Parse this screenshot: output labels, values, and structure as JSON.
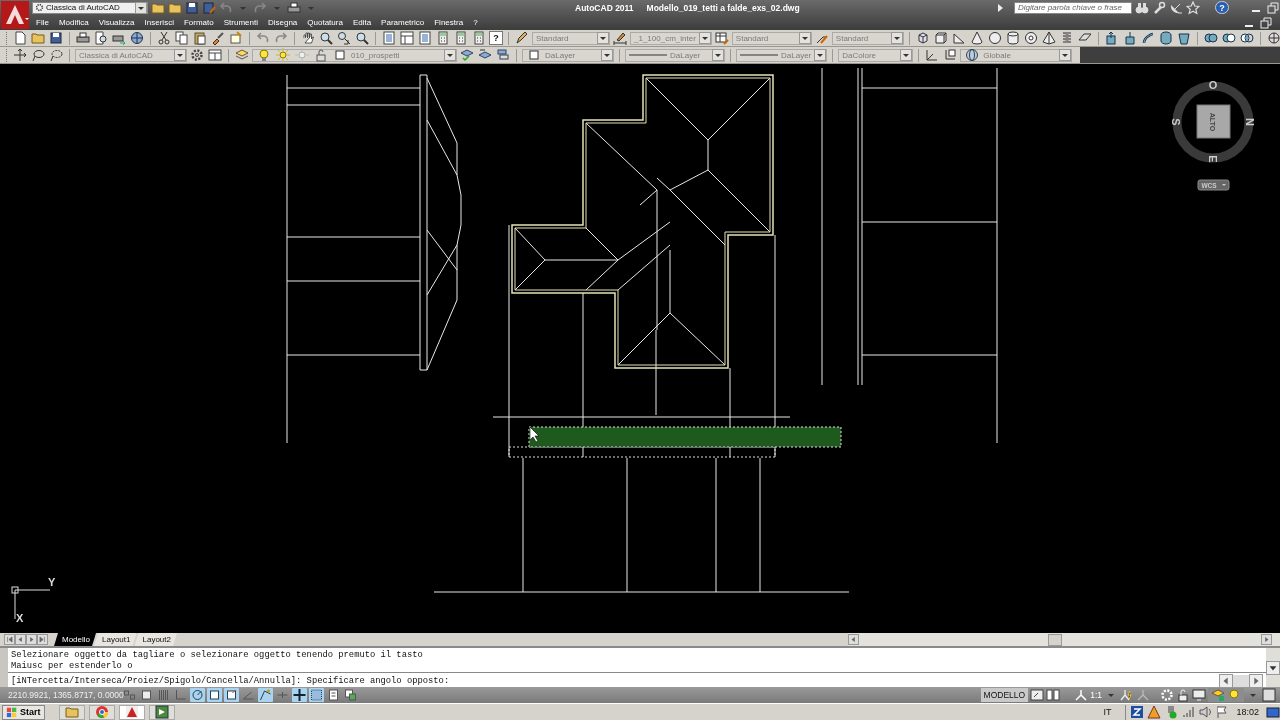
{
  "title_bar": {
    "workspace": "Classica di AutoCAD",
    "app_name": "AutoCAD 2011",
    "document": "Modello_019_tetti a falde_exs_02.dwg",
    "search": {
      "placeholder": "Digitare parola chiave o frase"
    },
    "help": "?"
  },
  "menu": [
    "File",
    "Modifica",
    "Visualizza",
    "Inserisci",
    "Formato",
    "Strumenti",
    "Disegna",
    "Quotatura",
    "Edita",
    "Parametrico",
    "Finestra",
    "?"
  ],
  "toolbar_1": {
    "help": "?",
    "styles": [
      {
        "value": "Standard"
      },
      {
        "value": "_1_100_cm_inter"
      },
      {
        "value": "Standard"
      },
      {
        "value": "Standard"
      }
    ]
  },
  "toolbar_2": {
    "workspace": "Classica di AutoCAD",
    "layer": "010_prospetti",
    "object_color": "DaLayer",
    "linetype": "DaLayer",
    "lineweight": "DaLayer",
    "plot_style": "DaColore",
    "ucs": "Globale"
  },
  "viewcube": {
    "west": "O",
    "south": "S",
    "north": "N",
    "east": "E",
    "face": "ALTO",
    "coordinate_system": "WCS"
  },
  "ucs_icon": {
    "y": "Y",
    "x": "X"
  },
  "layout_tabs": [
    {
      "label": "Modello",
      "selected": true
    },
    {
      "label": "Layout1",
      "selected": false
    },
    {
      "label": "Layout2",
      "selected": false
    }
  ],
  "command_line": {
    "history": [
      "Selezionare oggetto da tagliare o selezionare oggetto tenendo premuto il tasto",
      "Maiusc per estenderlo o"
    ],
    "prompt": "[iNTercetta/Interseca/Proiez/Spigolo/Cancella/Annulla]: Specificare angolo opposto:"
  },
  "status_bar": {
    "coordinates": "2210.9921, 1365.8717, 0.0000",
    "toggles": [
      {
        "kind": "infer",
        "on": false
      },
      {
        "kind": "snap",
        "on": false
      },
      {
        "kind": "grid",
        "on": false
      },
      {
        "kind": "ortho",
        "on": false
      },
      {
        "kind": "polar",
        "on": true
      },
      {
        "kind": "osnap",
        "on": true
      },
      {
        "kind": "osnap3d",
        "on": true
      },
      {
        "kind": "otrack",
        "on": false
      },
      {
        "kind": "ducs",
        "on": true
      },
      {
        "kind": "dyn",
        "on": false
      },
      {
        "kind": "lwt",
        "on": true
      },
      {
        "kind": "tpy",
        "on": true
      },
      {
        "kind": "qp",
        "on": false
      },
      {
        "kind": "sc",
        "on": false
      }
    ],
    "space": "MODELLO",
    "annotation_scale": "1:1"
  },
  "taskbar": {
    "start": "Start",
    "language": "IT",
    "time": "18:02"
  }
}
